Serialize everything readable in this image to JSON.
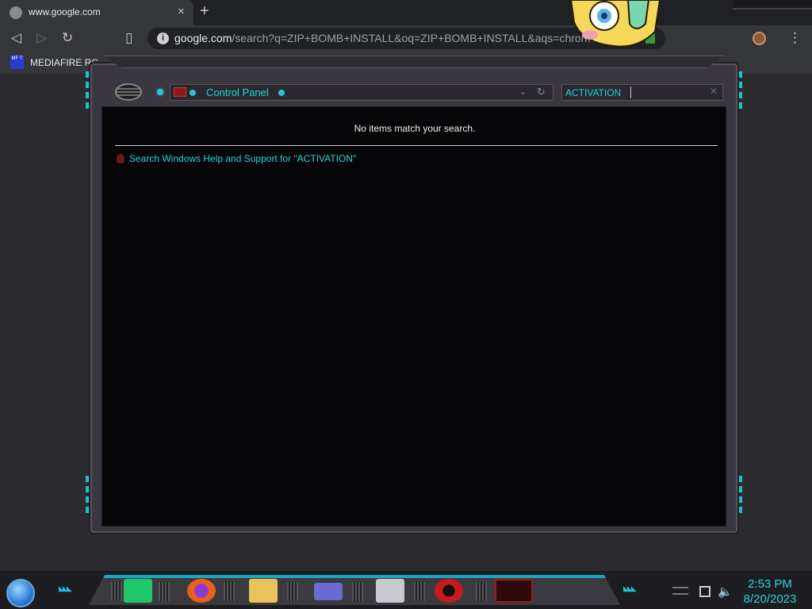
{
  "browser": {
    "tab_title": "www.google.com",
    "tab_close": "×",
    "new_tab": "+",
    "url_domain": "google.com",
    "url_path": "/search?q=ZIP+BOMB+INSTALL&oq=ZIP+BOMB+INSTALL&aqs=chrome...",
    "bookmark_label": "MEDIAFIRE RC",
    "bookmark_icon_text": "MF T",
    "back_icon": "◁",
    "forward_icon": "▷",
    "reload_icon": "↻",
    "bookmark_star_icon": "▯",
    "menu_icon": "⋮"
  },
  "control_panel": {
    "address_label": "Control Panel",
    "search_value": "ACTIVATION",
    "chevron": "⌄",
    "refresh": "↻",
    "clear": "✕",
    "no_items_text": "No items match your search.",
    "help_link_text": "Search Windows Help and Support for \"ACTIVATION\""
  },
  "taskbar": {
    "apps": [
      {
        "name": "notes-app",
        "color": "#1fc86a"
      },
      {
        "name": "firefox",
        "color": "#e8601a"
      },
      {
        "name": "file-explorer",
        "color": "#e8c25a"
      },
      {
        "name": "control-panel-app",
        "color": "#6a6ad0"
      },
      {
        "name": "documents-app",
        "color": "#c8c8d0"
      },
      {
        "name": "radiation-app",
        "color": "#c81a1a"
      },
      {
        "name": "red-console-app",
        "color": "#a01a1a"
      }
    ],
    "clock_time": "2:53 PM",
    "clock_date": "8/20/2023",
    "chevrons": "◣◣◣",
    "volume_icon": "🔈"
  },
  "colors": {
    "accent_cyan": "#23d5e0",
    "window_frame": "#3a3740",
    "content_bg": "#060608"
  }
}
